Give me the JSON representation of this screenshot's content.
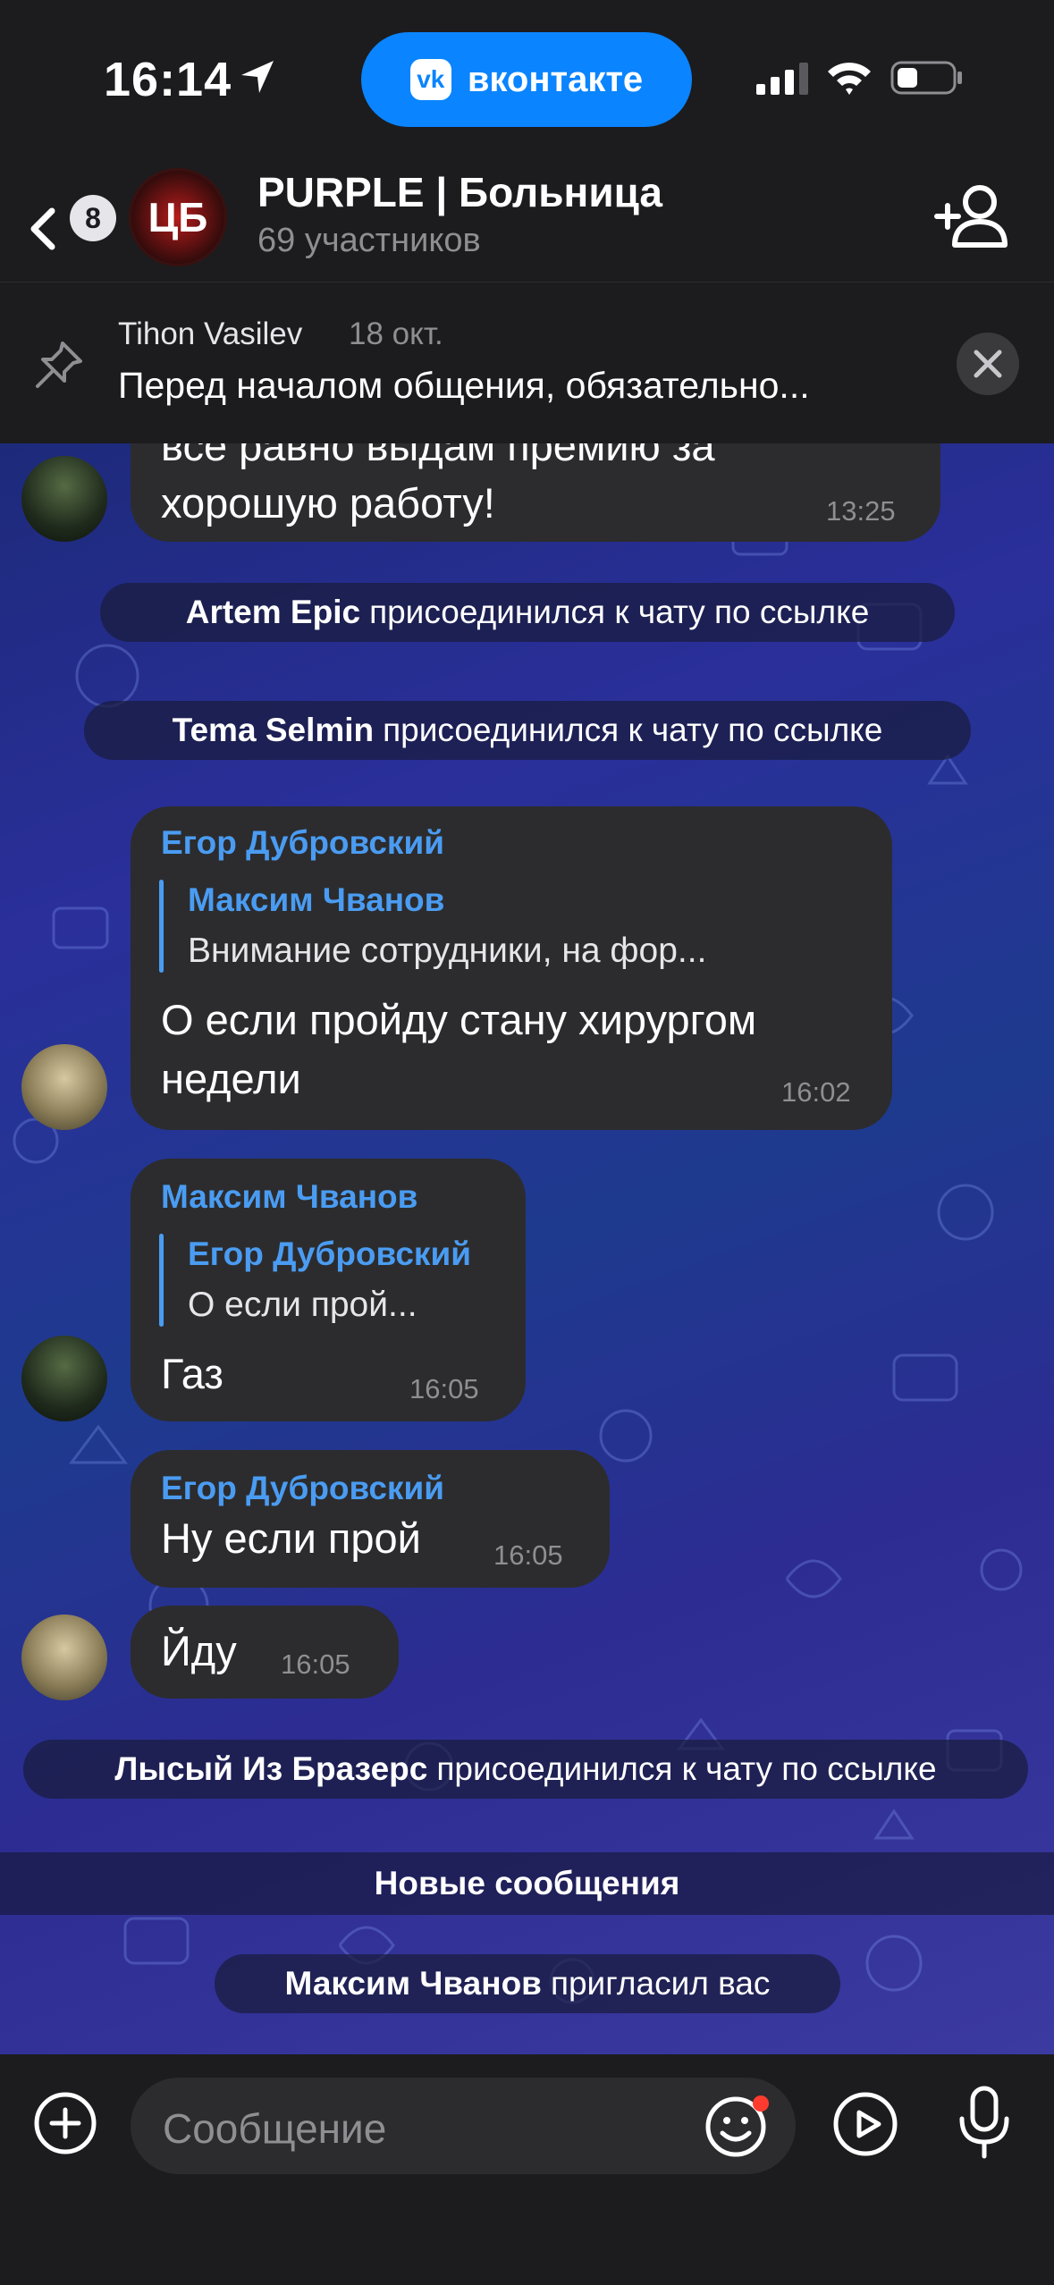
{
  "status_bar": {
    "time": "16:14",
    "app_pill_label": "вконтакте",
    "app_pill_logo": "vk"
  },
  "header": {
    "back_badge": "8",
    "chat_avatar_text": "ЦБ",
    "title": "PURPLE | Больница",
    "subtitle": "69 участников"
  },
  "pinned": {
    "author": "Tihon Vasilev",
    "date": "18 окт.",
    "text": "Перед началом общения, обязательно..."
  },
  "messages": [
    {
      "text_lines": [
        "все равно выдам премию за",
        "хорошую работу!"
      ],
      "time": "13:25"
    },
    {
      "author": "Егор Дубровский",
      "quote_author": "Максим Чванов",
      "quote_text": "Внимание сотрудники, на фор...",
      "text_lines": [
        "О если пройду стану хирургом",
        "недели"
      ],
      "time": "16:02"
    },
    {
      "author": "Максим Чванов",
      "quote_author": "Егор Дубровский",
      "quote_text": "О если прой...",
      "text": "Газ",
      "time": "16:05"
    },
    {
      "author": "Егор Дубровский",
      "text": "Ну если прой",
      "time": "16:05"
    },
    {
      "text": "Йду",
      "time": "16:05"
    }
  ],
  "system_events": [
    {
      "name": "Artem Epic",
      "action": "присоединился к чату по ссылке"
    },
    {
      "name": "Tema Selmin",
      "action": "присоединился к чату по ссылке"
    },
    {
      "name": "Лысый Из Бразерс",
      "action": "присоединился к чату по ссылке"
    },
    {
      "name": "Максим Чванов",
      "action": "пригласил вас"
    }
  ],
  "new_messages_divider": "Новые сообщения",
  "input": {
    "placeholder": "Сообщение"
  },
  "colors": {
    "accent_blue": "#0a84ff",
    "author_blue": "#4a9cf2",
    "bubble": "#2c2c2e",
    "background": "#1c1c1e",
    "notification_dot": "#ff3b30"
  },
  "icons": [
    "location-arrow-icon",
    "vk-logo-icon",
    "cellular-signal-icon",
    "wifi-icon",
    "battery-icon",
    "back-chevron-icon",
    "add-member-icon",
    "pin-icon",
    "close-icon",
    "plus-circle-icon",
    "emoji-icon",
    "video-message-icon",
    "microphone-icon"
  ]
}
